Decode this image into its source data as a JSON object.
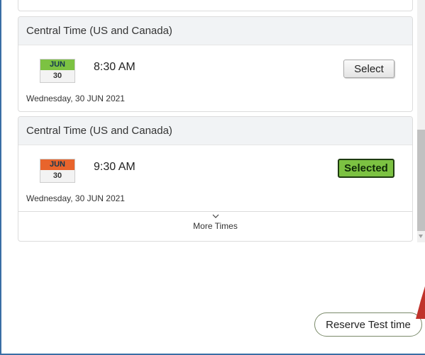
{
  "slots": [
    {
      "timezone": "Central Time (US and Canada)",
      "month": "JUN",
      "day": "30",
      "time": "8:30 AM",
      "date": "Wednesday, 30 JUN 2021",
      "button_label": "Select",
      "state": "available",
      "month_color": "#7cc242"
    },
    {
      "timezone": "Central Time (US and Canada)",
      "month": "JUN",
      "day": "30",
      "time": "9:30 AM",
      "date": "Wednesday, 30 JUN 2021",
      "button_label": "Selected",
      "state": "selected",
      "month_color": "#e8642c"
    }
  ],
  "more_times": {
    "label": "More Times",
    "icon": "chevron-down-icon"
  },
  "reserve": {
    "label": "Reserve Test time"
  },
  "colors": {
    "selected_green": "#7cc242",
    "accent_orange": "#e8642c",
    "annotation_red": "#c0322a",
    "frame_blue": "#3a6ea5"
  }
}
